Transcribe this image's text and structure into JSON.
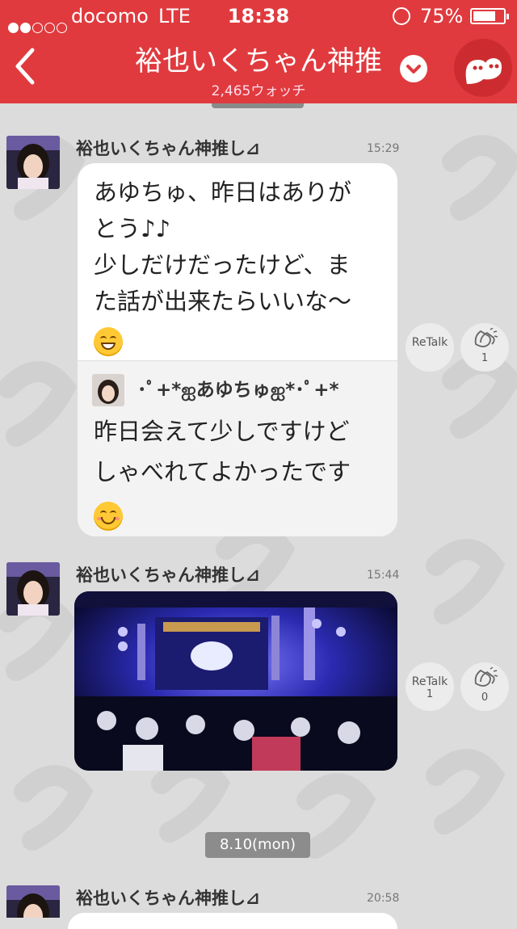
{
  "status_bar": {
    "signal_dots_filled": 2,
    "signal_dots_total": 5,
    "carrier": "docomo",
    "network": "LTE",
    "time": "18:38",
    "battery_text": "75%",
    "battery_level": 0.75
  },
  "header": {
    "title": "裕也いくちゃん神推",
    "watch_count": "2,465ウォッチ",
    "accent_color": "#e03a3e",
    "back_icon": "chevron-left-icon",
    "menu_icon": "chevron-down-icon",
    "mascot_icon": "mascot-icon"
  },
  "messages": [
    {
      "username": "裕也いくちゃん神推し⊿",
      "time": "15:29",
      "text_lines": [
        "あゆちゅ、昨日はありが",
        "とう♪♪",
        "少しだけだったけど、ま",
        "た話が出来たらいいな〜"
      ],
      "emoji": "grin-emoji",
      "reply": {
        "username": "･ﾟ+*ஐあゆちゅஐ*･ﾟ+*",
        "text_lines": [
          "昨日会えて少しですけど",
          "しゃべれてよかったです"
        ],
        "emoji": "smile-emoji"
      },
      "retalk_label": "ReTalk",
      "retalk_count": "",
      "clap_count": "1"
    },
    {
      "username": "裕也いくちゃん神推し⊿",
      "time": "15:44",
      "photo": "concert-stage-photo",
      "retalk_label": "ReTalk",
      "retalk_count": "1",
      "clap_count": "0"
    },
    {
      "username": "裕也いくちゃん神推し⊿",
      "time": "20:58"
    }
  ],
  "date_separator": "8.10(mon)"
}
